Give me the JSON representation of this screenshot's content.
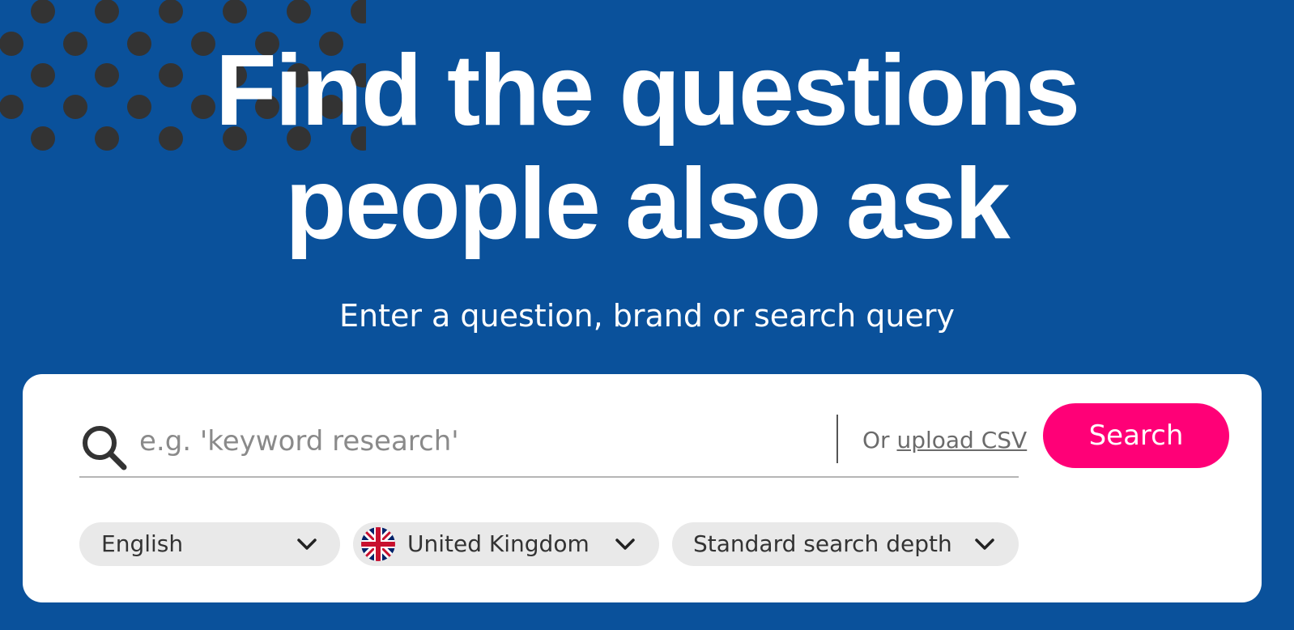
{
  "hero": {
    "title_line1": "Find the questions",
    "title_line2": "people also ask",
    "subtitle": "Enter a question, brand or search query"
  },
  "search": {
    "placeholder": "e.g. 'keyword research'",
    "value": "",
    "or_text": "Or",
    "upload_label": "upload CSV",
    "button_label": "Search"
  },
  "filters": {
    "language": {
      "selected": "English",
      "icon": "chevron-down-icon"
    },
    "country": {
      "selected": "United Kingdom",
      "icon": "uk-flag-icon"
    },
    "depth": {
      "selected": "Standard search depth",
      "icon": "chevron-down-icon"
    }
  },
  "colors": {
    "background": "#0a519b",
    "accent": "#ff0077",
    "dots": "#333333",
    "card": "#ffffff",
    "select_bg": "#e9e9e9"
  }
}
